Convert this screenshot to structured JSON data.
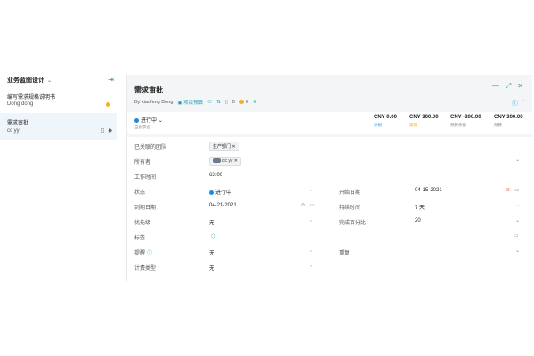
{
  "sidebar": {
    "title": "业务蓝图设计",
    "items": [
      {
        "title": "编写需求规格说明书",
        "owner": "Dong dong"
      },
      {
        "title": "需求审批",
        "owner": "cc yy"
      }
    ]
  },
  "panel": {
    "title": "需求审批",
    "meta": {
      "by": "By xiaofeng Dong",
      "project_label": "项目预算",
      "count1": "0",
      "count2": "0",
      "coin_count": "0"
    }
  },
  "stats": {
    "status_value": "进行中",
    "status_sub": "当前状态",
    "items": [
      {
        "value": "CNY 0.00",
        "label": "计划"
      },
      {
        "value": "CNY 300.00",
        "label": "实际"
      },
      {
        "value": "CNY -300.00",
        "label": "预算余额"
      },
      {
        "value": "CNY 300.00",
        "label": "预算"
      }
    ]
  },
  "form": {
    "team_label": "已关联的团队",
    "team_value": "生产部门",
    "owner_label": "所有者",
    "owner_value": "cc yy",
    "worktime_label": "工作时间",
    "worktime_value": "63:00",
    "status_label": "状态",
    "status_value": "进行中",
    "start_label": "开始日期",
    "start_value": "04-15-2021",
    "due_label": "到期日期",
    "due_value": "04-21-2021",
    "duration_label": "持续时间",
    "duration_value": "7 天",
    "priority_label": "优先级",
    "priority_value": "无",
    "percent_label": "完成百分比",
    "percent_value": "20",
    "tags_label": "标签",
    "remind_label": "提醒",
    "remind_value": "无",
    "repeat_label": "重复",
    "billing_label": "计费类型",
    "billing_value": "无"
  },
  "colors": {
    "accent": "#1a9fb5",
    "status_blue": "#1a8cde",
    "coin": "#f2b01e"
  }
}
